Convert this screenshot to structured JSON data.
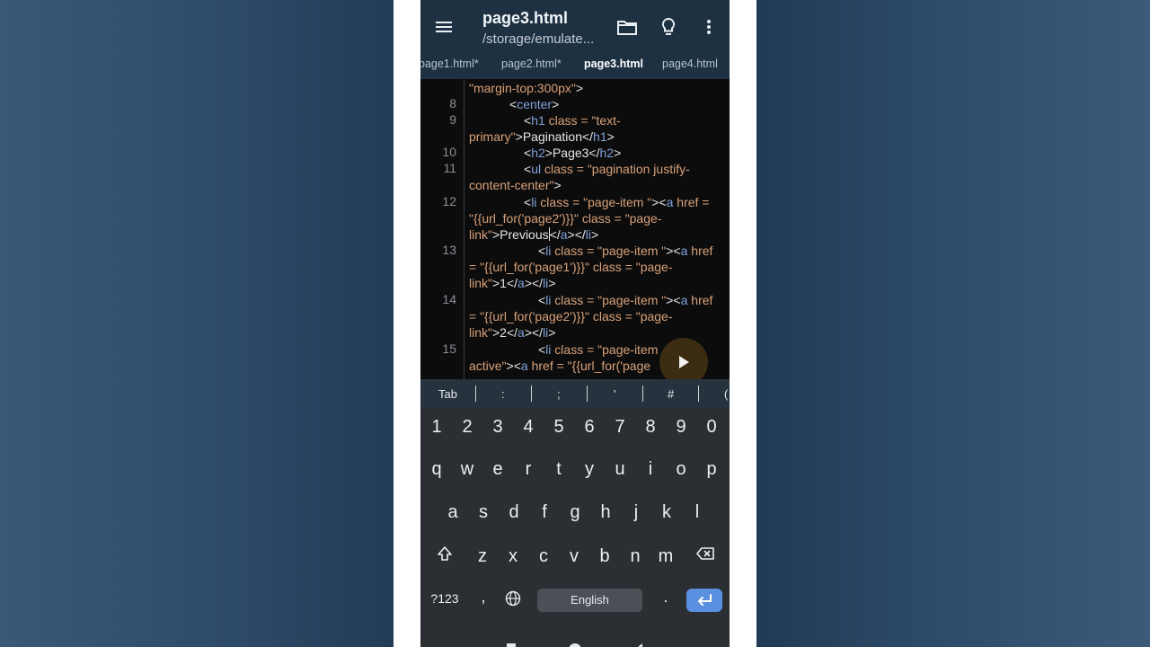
{
  "app": {
    "title": "page3.html",
    "path": "/storage/emulate...",
    "icons": {
      "menu": "hamburger-menu-icon",
      "folder": "folder-icon",
      "hint": "lightbulb-icon",
      "more": "vertical-dots-icon",
      "run": "play-icon"
    }
  },
  "tabs": [
    "page1.html*",
    "page2.html*",
    "page3.html",
    "page4.html"
  ],
  "active_tab": "page3.html",
  "editor": {
    "line_numbers": [
      "8",
      "9",
      "10",
      "11",
      "12",
      "13",
      "14",
      "15"
    ],
    "code": {
      "l0": {
        "a1": "\"margin-top:300px\"",
        "p1": ">"
      },
      "l8": {
        "p1": "<",
        "t1": "center",
        "p2": ">"
      },
      "l9a": {
        "p1": "<",
        "t1": "h1",
        "a1": " class = \"text-"
      },
      "l9b": {
        "a1": "primary\"",
        "p1": ">Pagination</",
        "t1": "h1",
        "p2": ">"
      },
      "l10": {
        "p1": "<",
        "t1": "h2",
        "p2": ">Page3</",
        "t2": "h2",
        "p3": ">"
      },
      "l11a": {
        "p1": "<",
        "t1": "ul",
        "a1": " class = \"pagination justify-"
      },
      "l11b": {
        "a1": "content-center\"",
        "p1": ">"
      },
      "l12a": {
        "p1": "<",
        "t1": "li",
        "a1": " class = \"page-item \"",
        "p2": "><",
        "t2": "a",
        "a2": " href ="
      },
      "l12b": {
        "a1": "\"{{url_for('page2')}}\" class = \"page-"
      },
      "l12c": {
        "a1": "link\"",
        "p1": ">Previous",
        "p2": "</",
        "t1": "a",
        "p3": "></",
        "t2": "li",
        "p4": ">"
      },
      "l13a": {
        "p1": "<",
        "t1": "li",
        "a1": " class = \"page-item \"",
        "p2": "><",
        "t2": "a",
        "a2": " href"
      },
      "l13b": {
        "a1": "= \"{{url_for('page1')}}\" class = \"page-"
      },
      "l13c": {
        "a1": "link\"",
        "p1": ">1</",
        "t1": "a",
        "p2": "></",
        "t2": "li",
        "p3": ">"
      },
      "l14a": {
        "p1": "<",
        "t1": "li",
        "a1": " class = \"page-item \"",
        "p2": "><",
        "t2": "a",
        "a2": " href"
      },
      "l14b": {
        "a1": "= \"{{url_for('page2')}}\" class = \"page-"
      },
      "l14c": {
        "a1": "link\"",
        "p1": ">2</",
        "t1": "a",
        "p2": "></",
        "t2": "li",
        "p3": ">"
      },
      "l15a": {
        "p1": "<",
        "t1": "li",
        "a1": " class = \"page-item"
      },
      "l15b": {
        "a1": "active\"",
        "p1": "><",
        "t1": "a",
        "a2": " href = \"{{url_for('page"
      }
    }
  },
  "symbol_bar": [
    "Tab",
    ":",
    ";",
    "'",
    "#",
    "("
  ],
  "keyboard": {
    "numbers": [
      "1",
      "2",
      "3",
      "4",
      "5",
      "6",
      "7",
      "8",
      "9",
      "0"
    ],
    "row1": [
      "q",
      "w",
      "e",
      "r",
      "t",
      "y",
      "u",
      "i",
      "o",
      "p"
    ],
    "row2": [
      "a",
      "s",
      "d",
      "f",
      "g",
      "h",
      "j",
      "k",
      "l"
    ],
    "row3": [
      "z",
      "x",
      "c",
      "v",
      "b",
      "n",
      "m"
    ],
    "sym_key": "?123",
    "comma": ",",
    "period": ".",
    "space_label": "English"
  },
  "colors": {
    "appbar": "#1e3142",
    "editor_bg": "#0c0c0d",
    "tag": "#7fa2d8",
    "attr": "#d9a178",
    "enter_key": "#5b8fe0"
  }
}
